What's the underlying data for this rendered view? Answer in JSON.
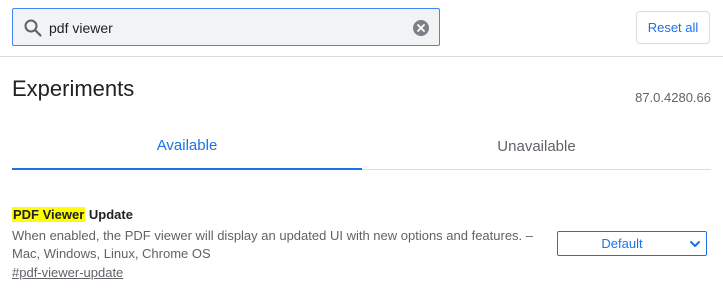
{
  "search": {
    "value": "pdf viewer",
    "icon": "search-icon",
    "clear_icon": "clear-circle-icon"
  },
  "header": {
    "reset_label": "Reset all"
  },
  "page": {
    "title": "Experiments",
    "version": "87.0.4280.66"
  },
  "tabs": [
    {
      "label": "Available",
      "active": true
    },
    {
      "label": "Unavailable",
      "active": false
    }
  ],
  "experiment": {
    "title_highlight": "PDF Viewer",
    "title_rest": " Update",
    "description": "When enabled, the PDF viewer will display an updated UI with new options and features. – Mac, Windows, Linux, Chrome OS",
    "link": "#pdf-viewer-update",
    "selected_option": "Default"
  },
  "colors": {
    "accent": "#1a73e8",
    "highlight": "#ffff00",
    "search_bg": "#f1f3f4",
    "border": "#dadce0"
  }
}
